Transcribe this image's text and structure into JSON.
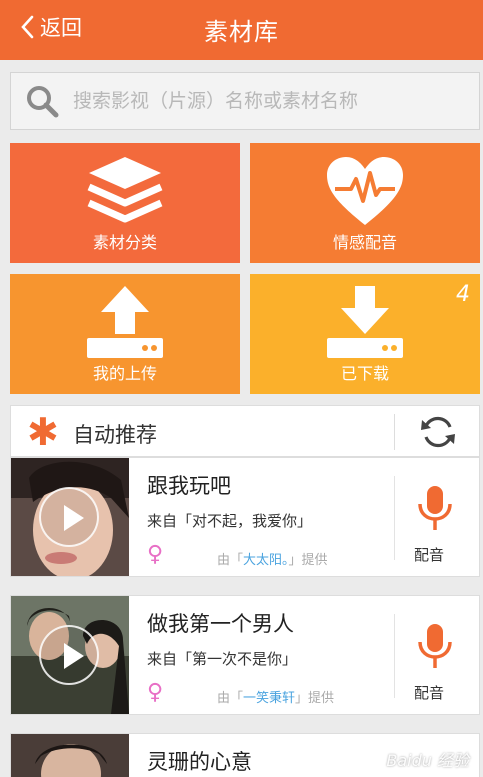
{
  "header": {
    "back_label": "返回",
    "title": "素材库"
  },
  "search": {
    "placeholder": "搜索影视（片源）名称或素材名称"
  },
  "tiles": [
    {
      "label": "素材分类",
      "icon": "layers-icon"
    },
    {
      "label": "情感配音",
      "icon": "heart-pulse-icon"
    },
    {
      "label": "我的上传",
      "icon": "upload-icon"
    },
    {
      "label": "已下载",
      "icon": "download-icon",
      "badge": "4"
    }
  ],
  "recommend": {
    "title": "自动推荐"
  },
  "items": [
    {
      "title": "跟我玩吧",
      "source": "来自「对不起，我爱你」",
      "provider_prefix": "由「",
      "provider": "大太阳。",
      "provider_suffix": "」提供",
      "action": "配音"
    },
    {
      "title": "做我第一个男人",
      "source": "来自「第一次不是你」",
      "provider_prefix": "由「",
      "provider": "一笑秉轩",
      "provider_suffix": "」提供",
      "action": "配音"
    },
    {
      "title": "灵珊的心意"
    }
  ],
  "watermark": "Baidu 经验",
  "colors": {
    "accent": "#f06a32",
    "female": "#e86fc6",
    "link": "#4aa3df"
  }
}
